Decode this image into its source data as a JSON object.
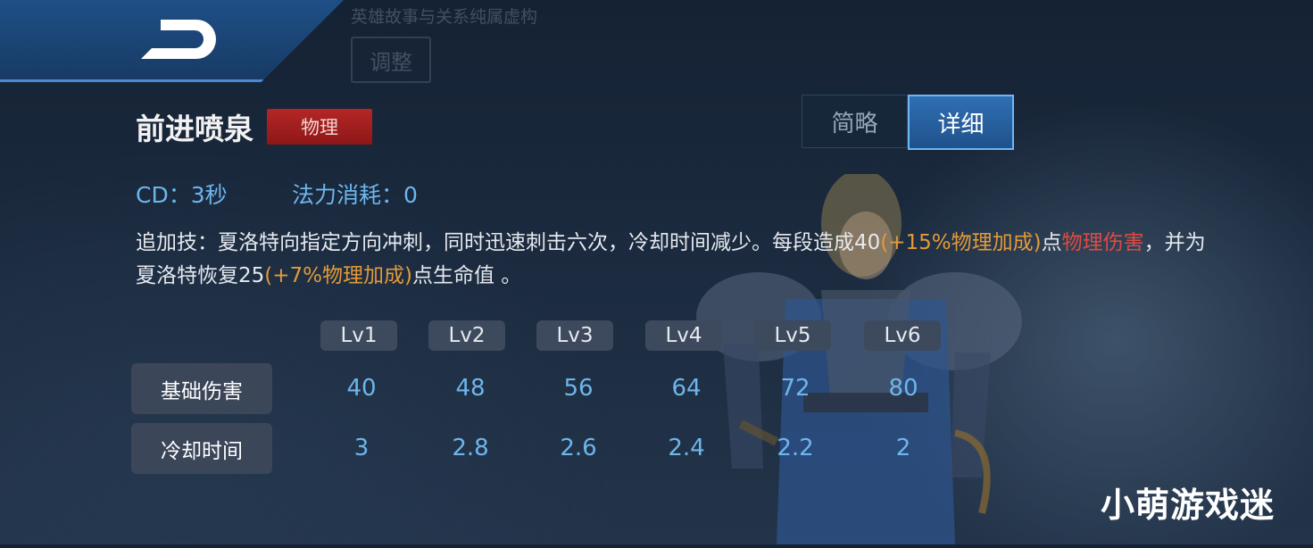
{
  "header": {
    "background_caption": "英雄故事与关系纯属虚构",
    "background_button": "调整",
    "back_icon": "back-arrow-icon"
  },
  "skill": {
    "name": "前进喷泉",
    "damage_type": "物理",
    "cd": "CD：3秒",
    "mana": "法力消耗：0"
  },
  "view_toggle": {
    "brief": "简略",
    "detail": "详细",
    "selected": "详细"
  },
  "description": {
    "p1": "追加技：夏洛特向指定方向冲刺，同时迅速刺击六次，冷却时间减少。每段造成40",
    "p2": "(+15%物理加成)",
    "p3": "点",
    "p4": "物理伤害",
    "p5": "，并为夏洛特恢复25",
    "p6": "(+7%物理加成)",
    "p7": "点生命值 。"
  },
  "level_table": {
    "levels": [
      "Lv1",
      "Lv2",
      "Lv3",
      "Lv4",
      "Lv5",
      "Lv6"
    ],
    "rows": [
      {
        "label": "基础伤害",
        "values": [
          "40",
          "48",
          "56",
          "64",
          "72",
          "80"
        ]
      },
      {
        "label": "冷却时间",
        "values": [
          "3",
          "2.8",
          "2.6",
          "2.4",
          "2.2",
          "2"
        ]
      }
    ]
  },
  "watermark": "小萌游戏迷",
  "colors": {
    "accent_blue": "#6db6ec",
    "bonus_orange": "#e39a39",
    "physical_red": "#e04a42",
    "badge_red": "#a51f1f"
  }
}
